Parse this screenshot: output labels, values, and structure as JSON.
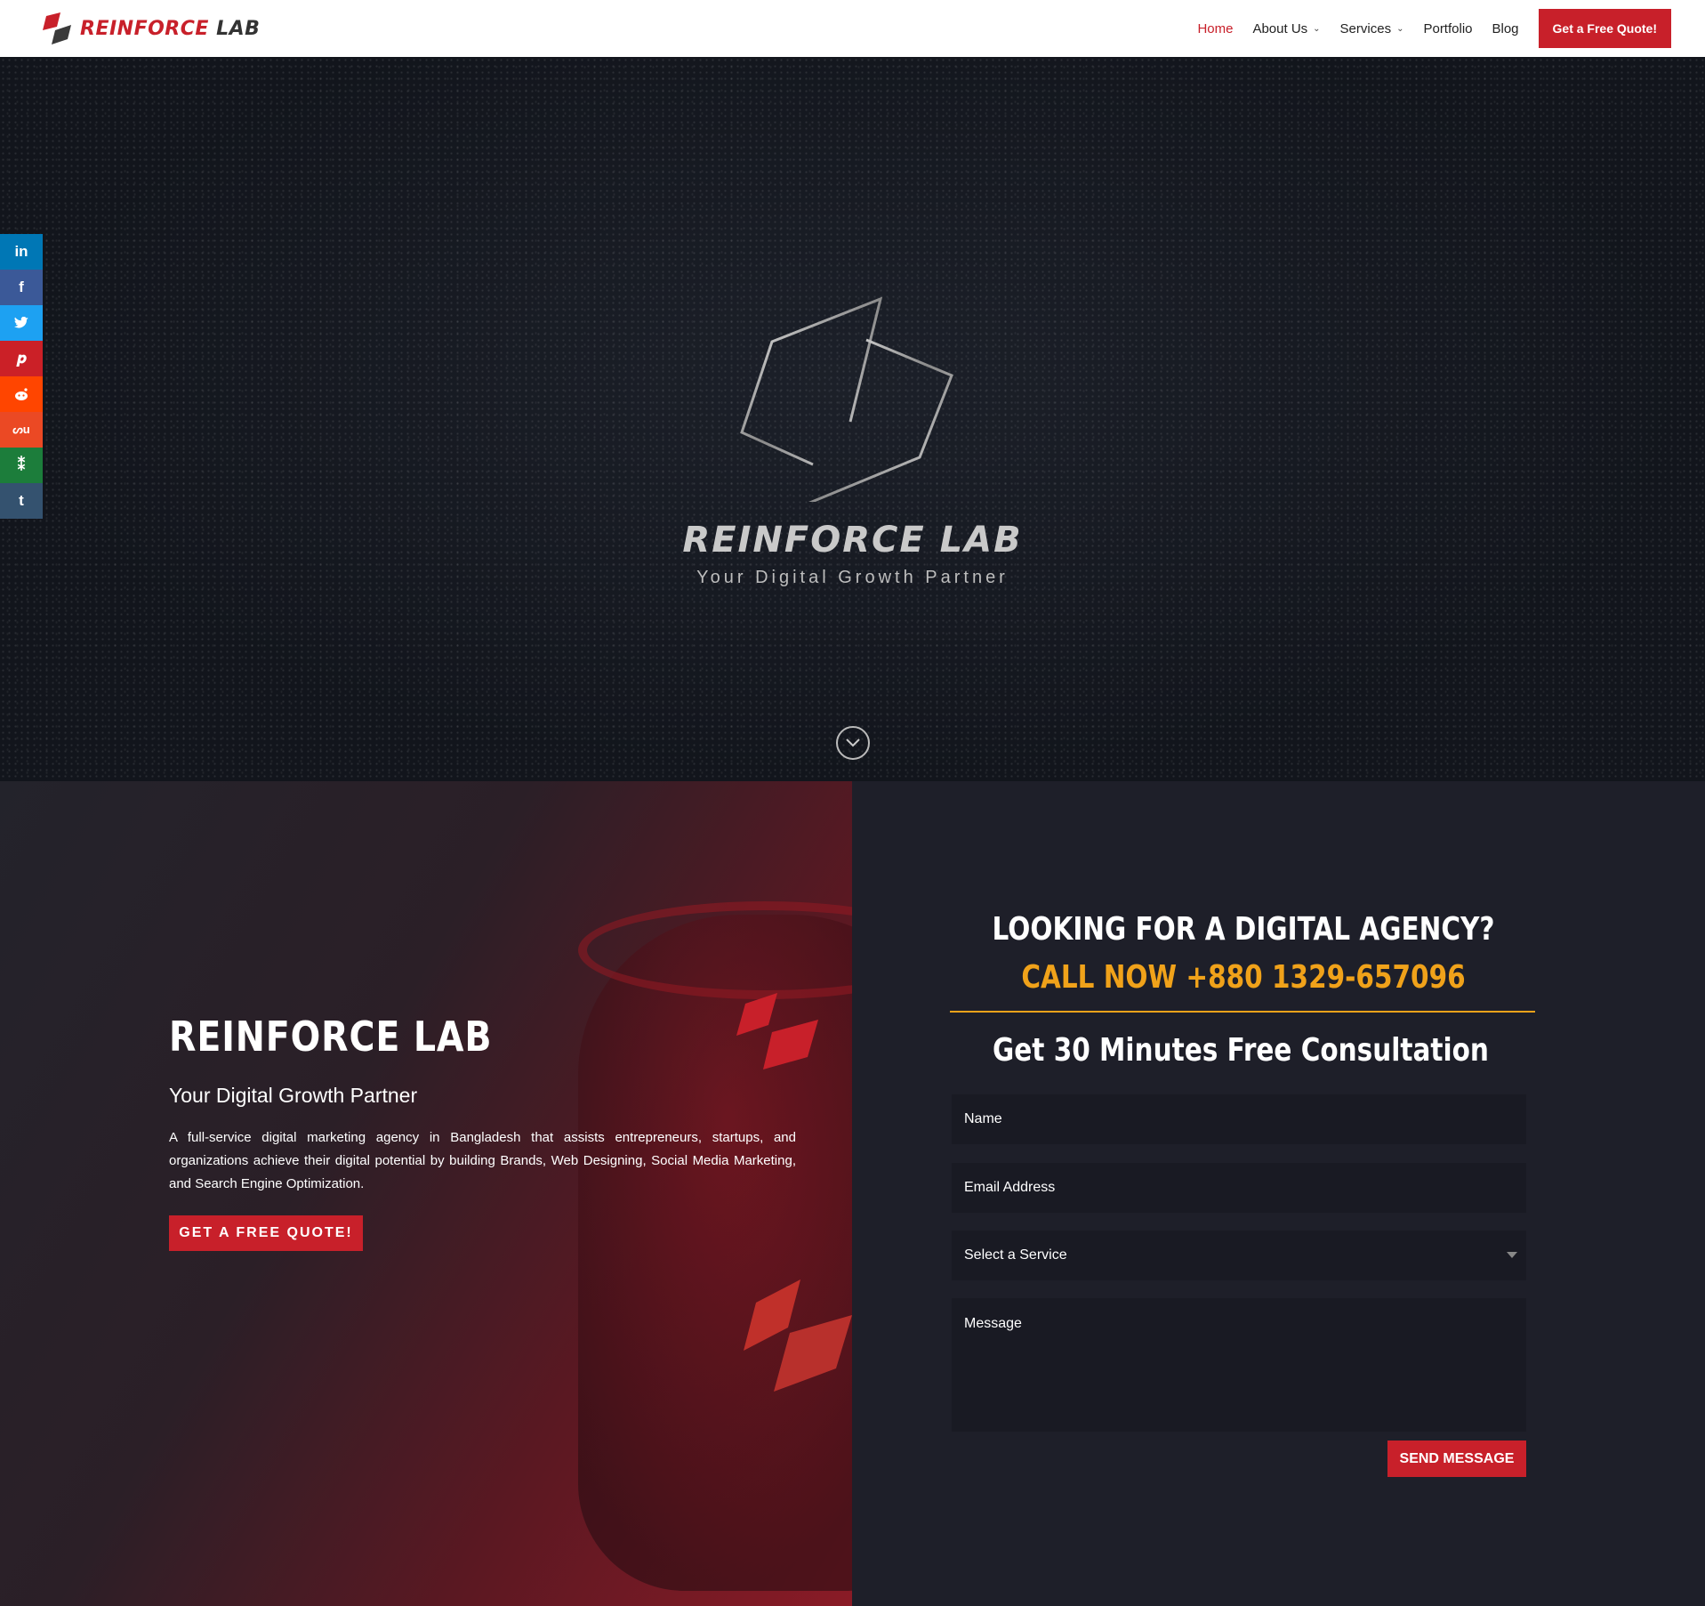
{
  "header": {
    "logo_red": "REINFORCE",
    "logo_dark": "LAB",
    "nav": [
      {
        "label": "Home",
        "active": true,
        "dropdown": false
      },
      {
        "label": "About Us",
        "active": false,
        "dropdown": true
      },
      {
        "label": "Services",
        "active": false,
        "dropdown": true
      },
      {
        "label": "Portfolio",
        "active": false,
        "dropdown": false
      },
      {
        "label": "Blog",
        "active": false,
        "dropdown": false
      }
    ],
    "cta_label": "Get a Free Quote!"
  },
  "hero": {
    "title": "REINFORCE LAB",
    "subtitle": "Your Digital Growth Partner",
    "scroll_icon": "chevron-down-circle-icon"
  },
  "social": [
    {
      "name": "linkedin",
      "glyph": "in",
      "color": "#0077b5"
    },
    {
      "name": "facebook",
      "glyph": "f",
      "color": "#3b5998"
    },
    {
      "name": "twitter",
      "glyph": "🐦",
      "color": "#1da1f2"
    },
    {
      "name": "pinterest",
      "glyph": "P",
      "color": "#cb2027"
    },
    {
      "name": "reddit",
      "glyph": "◉",
      "color": "#ff4500"
    },
    {
      "name": "stumbleupon",
      "glyph": "su",
      "color": "#eb4924"
    },
    {
      "name": "yummly",
      "glyph": "❦",
      "color": "#1c7d3b"
    },
    {
      "name": "tumblr",
      "glyph": "t",
      "color": "#34526f"
    }
  ],
  "about": {
    "title": "REINFORCE LAB",
    "subtitle": "Your Digital Growth Partner",
    "description": "A full-service digital marketing agency in Bangladesh that assists entrepreneurs, startups, and organizations achieve their digital potential by building Brands, Web Designing, Social Media Marketing, and Search Engine Optimization.",
    "button": "GET A FREE QUOTE!"
  },
  "contact": {
    "heading": "LOOKING FOR A DIGITAL AGENCY?",
    "call": "CALL NOW  +880 1329-657096",
    "consult": "Get 30 Minutes Free Consultation",
    "name_placeholder": "Name",
    "email_placeholder": "Email Address",
    "service_placeholder": "Select a Service",
    "message_placeholder": "Message",
    "send": "SEND MESSAGE"
  },
  "colors": {
    "brand_red": "#c8202a",
    "accent_orange": "#f0a21a",
    "dark_bg": "#1e1f29"
  }
}
